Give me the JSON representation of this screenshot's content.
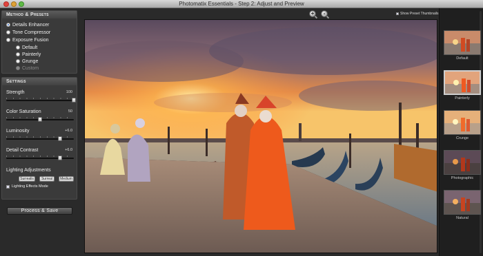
{
  "window": {
    "title": "Photomatix Essentials - Step 2: Adjust and Preview"
  },
  "method_presets": {
    "header": "Method & Presets",
    "options": [
      {
        "label": "Details Enhancer",
        "selected": true
      },
      {
        "label": "Tone Compressor",
        "selected": false
      },
      {
        "label": "Exposure Fusion",
        "selected": false
      }
    ],
    "sub_options": [
      {
        "label": "Default",
        "selected": false,
        "disabled": false
      },
      {
        "label": "Painterly",
        "selected": false,
        "disabled": false
      },
      {
        "label": "Grunge",
        "selected": false,
        "disabled": false
      },
      {
        "label": "Custom",
        "selected": false,
        "disabled": true
      }
    ]
  },
  "settings": {
    "header": "Settings",
    "sliders": [
      {
        "label": "Strength",
        "value": "100",
        "fraction": 1.0
      },
      {
        "label": "Color Saturation",
        "value": "50",
        "fraction": 0.5
      },
      {
        "label": "Luminosity",
        "value": "+6.0",
        "fraction": 0.8
      },
      {
        "label": "Detail Contrast",
        "value": "+6.0",
        "fraction": 0.8
      }
    ],
    "lighting": {
      "title": "Lighting Adjustments",
      "options": [
        "Surrealis",
        "Surreal",
        "Medium"
      ],
      "checkbox_label": "Lighting Effects Mode"
    }
  },
  "process_button": "Process & Save",
  "toolbar": {
    "show_thumbnails_label": "Show Preset Thumbnails",
    "zoom_in_symbol": "+",
    "zoom_out_symbol": "-"
  },
  "presets": [
    {
      "label": "Default",
      "selected": false
    },
    {
      "label": "Painterly",
      "selected": true
    },
    {
      "label": "Crunge",
      "selected": false
    },
    {
      "label": "Photographic",
      "selected": false
    },
    {
      "label": "Natural",
      "selected": false
    }
  ],
  "colors": {
    "accent": "#2f6fd0",
    "panel": "#3a3a3a",
    "background": "#232323"
  }
}
